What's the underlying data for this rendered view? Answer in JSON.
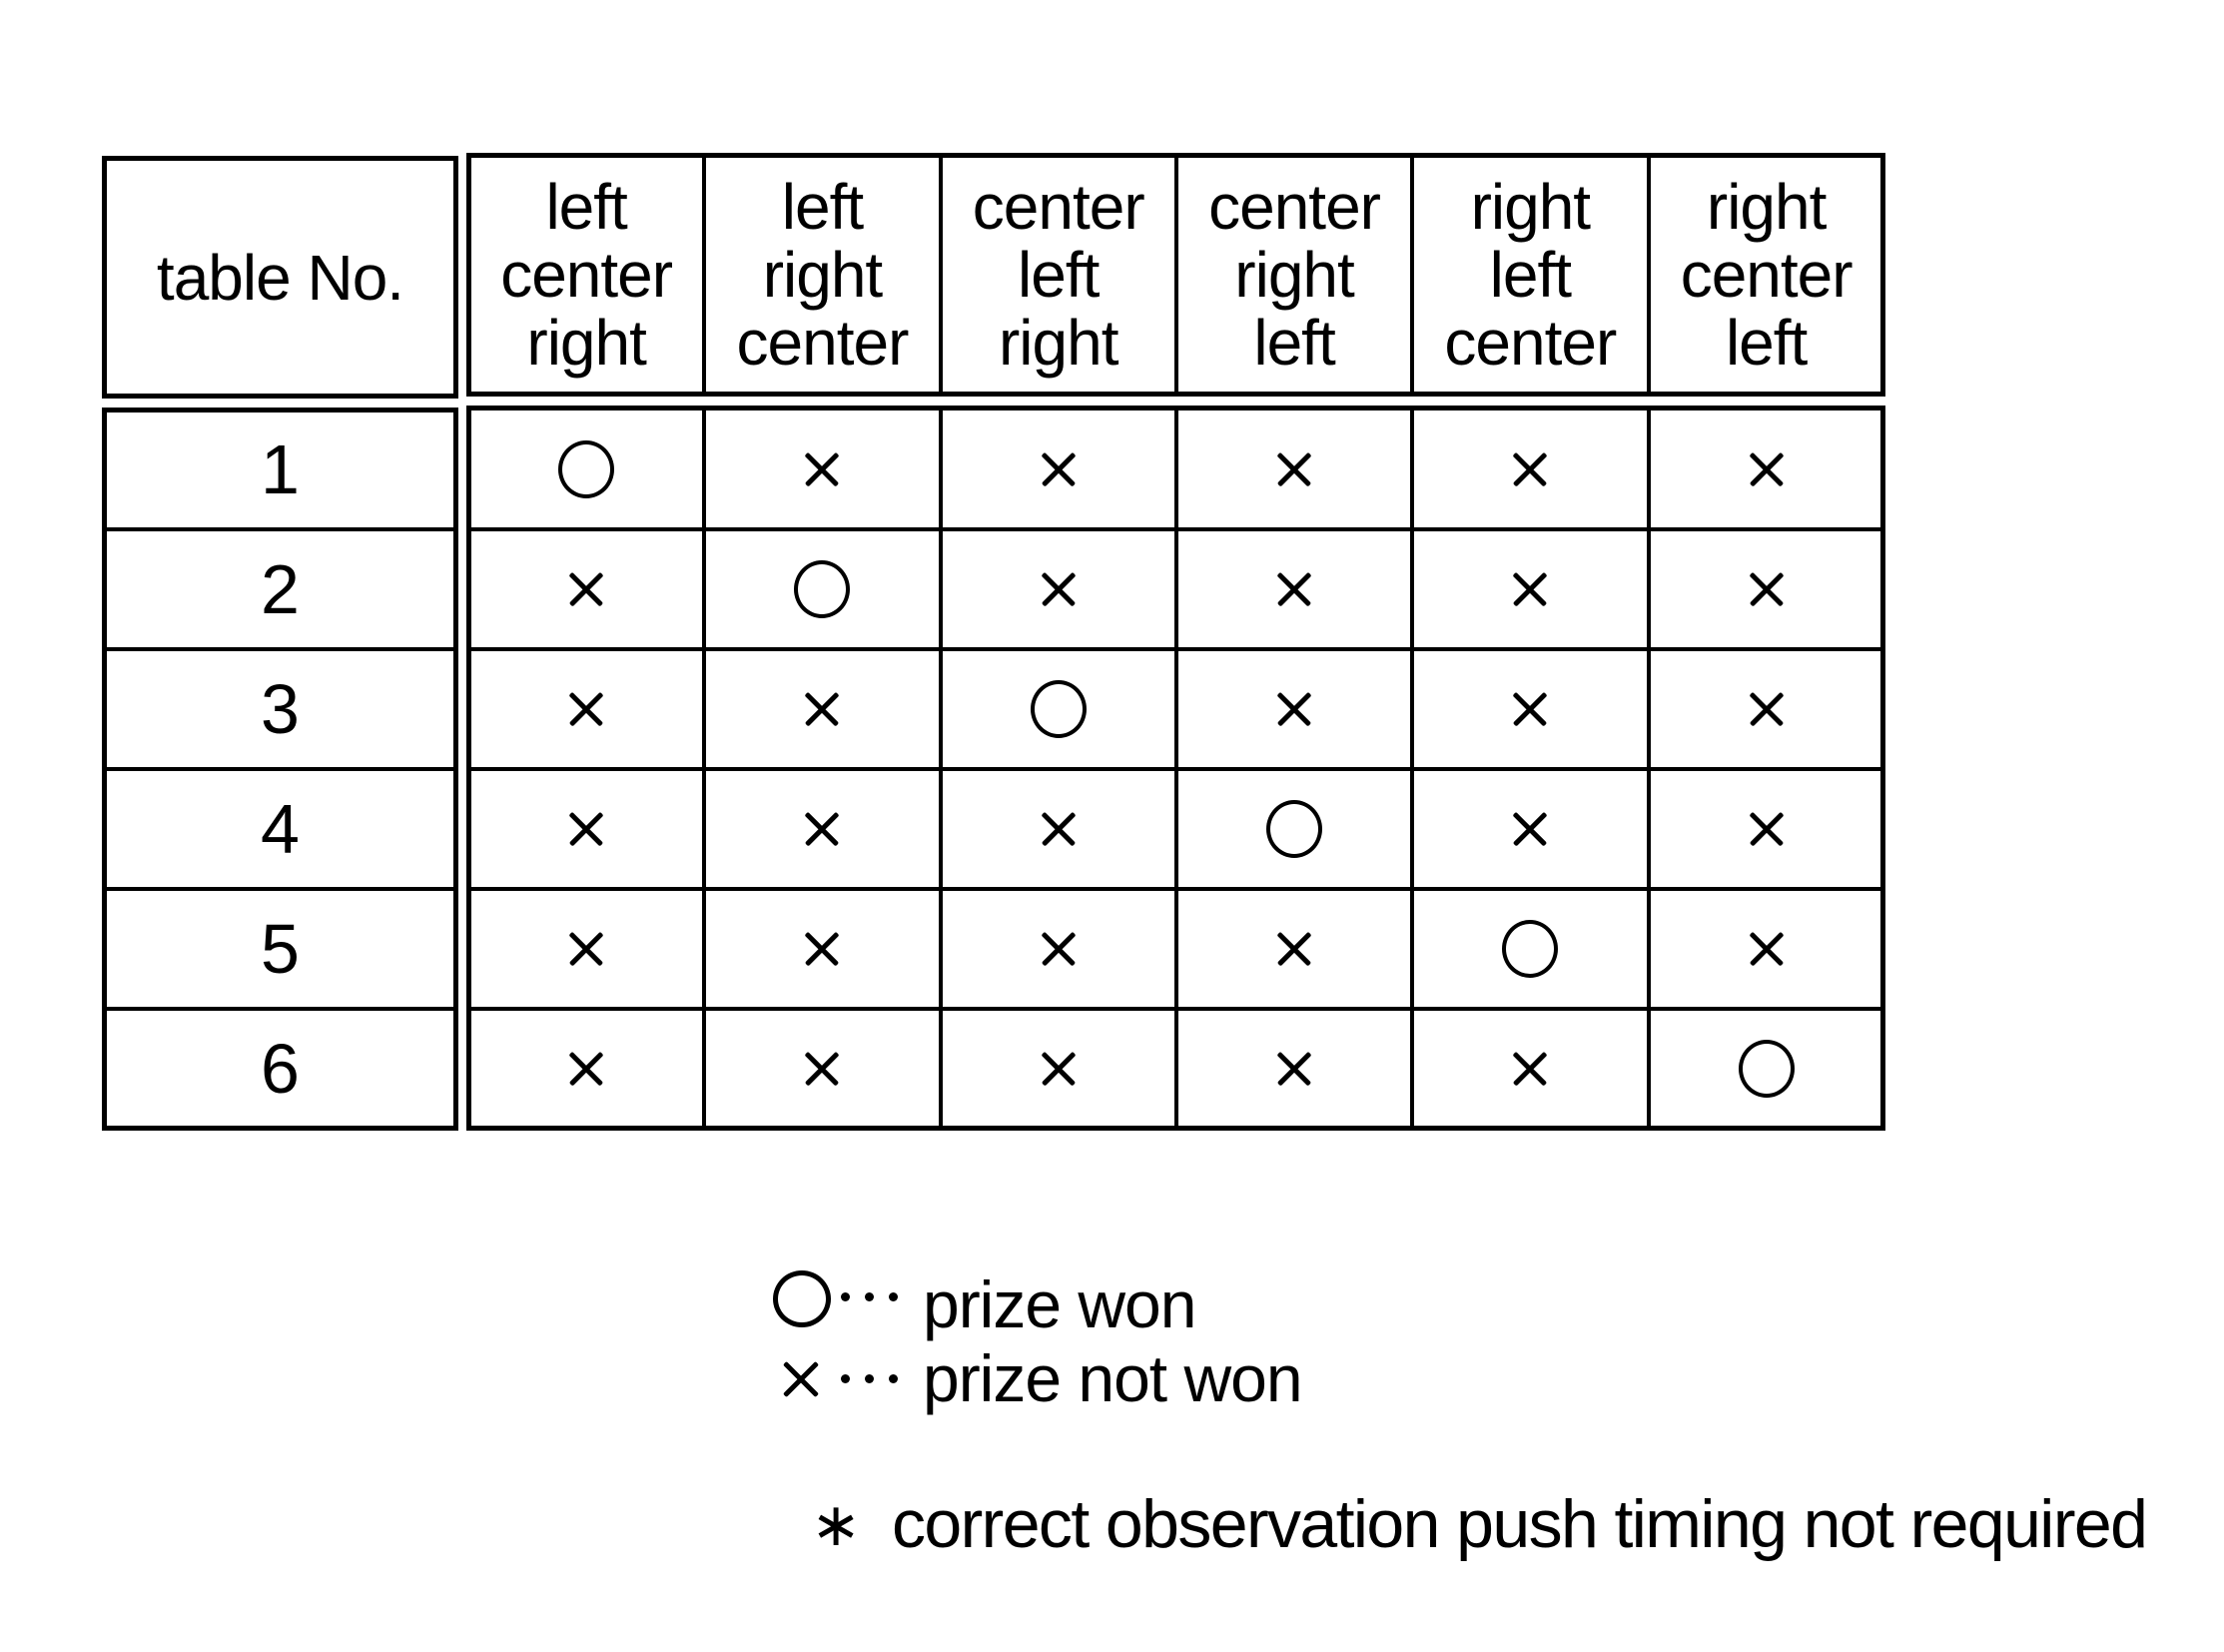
{
  "table": {
    "row_header_label": "table No.",
    "column_headers": [
      "left\ncenter\nright",
      "left\nright\ncenter",
      "center\nleft\nright",
      "center\nright\nleft",
      "right\nleft\ncenter",
      "right\ncenter\nleft"
    ],
    "rows": [
      {
        "table_no": "1",
        "cells": [
          "prize-won",
          "prize-not-won",
          "prize-not-won",
          "prize-not-won",
          "prize-not-won",
          "prize-not-won"
        ]
      },
      {
        "table_no": "2",
        "cells": [
          "prize-not-won",
          "prize-won",
          "prize-not-won",
          "prize-not-won",
          "prize-not-won",
          "prize-not-won"
        ]
      },
      {
        "table_no": "3",
        "cells": [
          "prize-not-won",
          "prize-not-won",
          "prize-won",
          "prize-not-won",
          "prize-not-won",
          "prize-not-won"
        ]
      },
      {
        "table_no": "4",
        "cells": [
          "prize-not-won",
          "prize-not-won",
          "prize-not-won",
          "prize-won",
          "prize-not-won",
          "prize-not-won"
        ]
      },
      {
        "table_no": "5",
        "cells": [
          "prize-not-won",
          "prize-not-won",
          "prize-not-won",
          "prize-not-won",
          "prize-won",
          "prize-not-won"
        ]
      },
      {
        "table_no": "6",
        "cells": [
          "prize-not-won",
          "prize-not-won",
          "prize-not-won",
          "prize-not-won",
          "prize-not-won",
          "prize-won"
        ]
      }
    ]
  },
  "legend": {
    "items": [
      {
        "symbol": "circle-icon",
        "label": "prize won"
      },
      {
        "symbol": "cross-icon",
        "label": "prize not won"
      }
    ],
    "separator": "···"
  },
  "note": {
    "marker": "∗",
    "text": "correct observation push timing not required"
  }
}
